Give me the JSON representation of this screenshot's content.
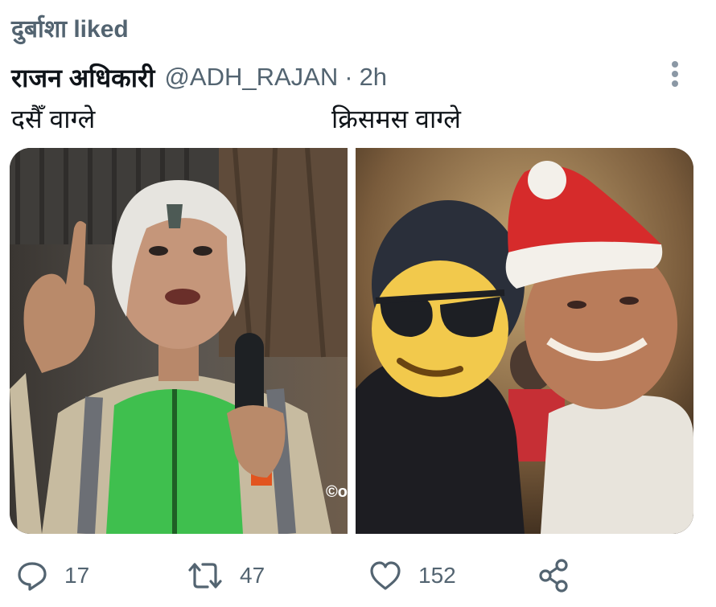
{
  "social_context": {
    "text": "दुर्बाशा liked",
    "icon": "heart-icon"
  },
  "tweet": {
    "author_name": "राजन अधिकारी",
    "author_handle": "@ADH_RAJAN",
    "separator": "·",
    "timestamp": "2h",
    "text_left": "दसैँ वाग्ले",
    "text_right": "क्रिसमस वाग्ले",
    "more_icon": "more-vertical-icon"
  },
  "media": {
    "left_image": "elderly man with tika, green vest, holding microphone",
    "right_image": "selfie of man in santa hat with person whose face is covered by sunglasses emoji",
    "watermark": "©o"
  },
  "actions": {
    "reply": {
      "icon": "reply-icon",
      "count": "17"
    },
    "retweet": {
      "icon": "retweet-icon",
      "count": "47"
    },
    "like": {
      "icon": "heart-icon",
      "count": "152"
    },
    "share": {
      "icon": "share-icon",
      "count": ""
    }
  },
  "colors": {
    "text_primary": "#0f1419",
    "text_secondary": "#536471",
    "emoji_yellow": "#f2c94c",
    "santa_red": "#d62b2b"
  }
}
